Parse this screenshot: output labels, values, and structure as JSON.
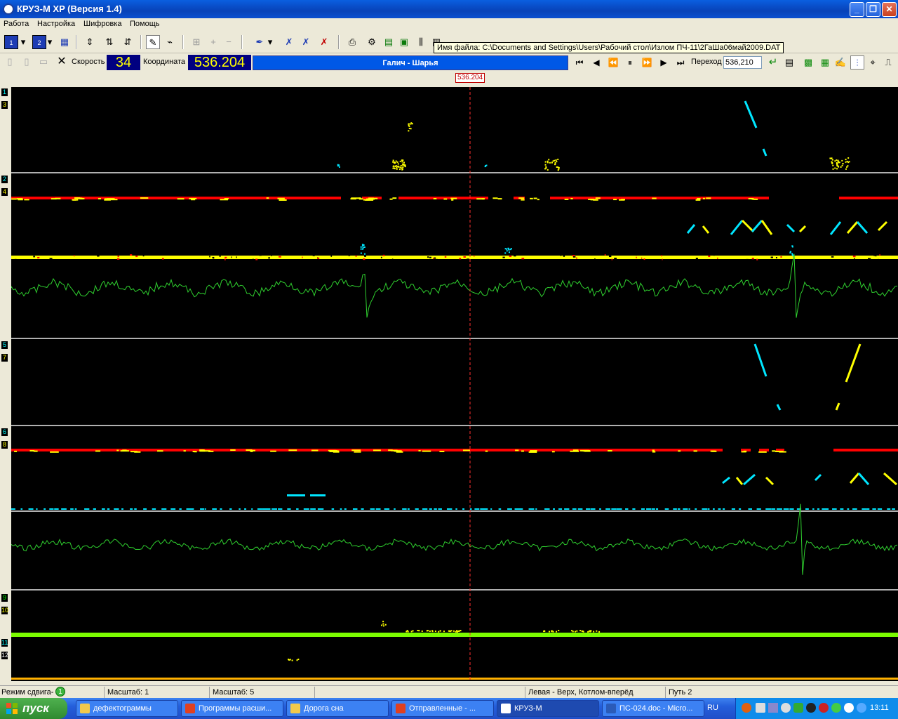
{
  "window": {
    "title": "КРУЗ-М XP (Версия 1.4)",
    "buttons": [
      "_",
      "❐",
      "✕"
    ]
  },
  "menu": [
    "Работа",
    "Настройка",
    "Шифровка",
    "Помощь"
  ],
  "tooltip": "Имя файла: C:\\Documents and Settings\\Users\\Рабочий стол\\Излом ПЧ-11\\2ГаШа06май2009.DAT",
  "nav": {
    "speed_label": "Скорость",
    "speed_value": "34",
    "coord_label": "Координата",
    "coord_value": "536.204",
    "route": "Галич - Шарья",
    "goto_label": "Переход",
    "goto_value": "536,210"
  },
  "ruler": {
    "marker": "536.204"
  },
  "channels": [
    {
      "label": "1",
      "color": "#00FFFF"
    },
    {
      "label": "3",
      "color": "#FFFF00"
    },
    {
      "label": "2",
      "color": "#00FFFF"
    },
    {
      "label": "4",
      "color": "#FFFF00"
    },
    {
      "label": "5",
      "color": "#00FFFF"
    },
    {
      "label": "7",
      "color": "#FFFF00"
    },
    {
      "label": "6",
      "color": "#00FFFF"
    },
    {
      "label": "8",
      "color": "#FFFF00"
    },
    {
      "label": "9",
      "color": "#00FF00"
    },
    {
      "label": "10",
      "color": "#FFFF00"
    },
    {
      "label": "11",
      "color": "#00FFFF"
    },
    {
      "label": "12",
      "color": "#FFFFFF"
    }
  ],
  "status": {
    "shift_mode": "Режим сдвига-",
    "shift_value": "1",
    "scale1": "Масштаб: 1",
    "scale2": "Масштаб: 5",
    "direction": "Левая - Верх, Котлом-вперёд",
    "track": "Путь 2"
  },
  "taskbar": {
    "start": "пуск",
    "tasks": [
      {
        "label": "дефектограммы",
        "icon": "folder-icon"
      },
      {
        "label": "Программы расши...",
        "icon": "opera-icon"
      },
      {
        "label": "Дорога сна",
        "icon": "folder-icon"
      },
      {
        "label": "Отправленные - ...",
        "icon": "opera-icon"
      },
      {
        "label": "КРУЗ-М",
        "icon": "app-icon",
        "active": true
      },
      {
        "label": "ПС-024.doc - Micro...",
        "icon": "word-icon"
      }
    ],
    "lang": "RU",
    "clock": "13:11"
  },
  "colors": {
    "cyan": "#00E6FF",
    "yellow": "#FFFF00",
    "red": "#FF0000",
    "green_trace": "#2FD02F",
    "lime": "#7CFC00",
    "cursor": "#FF3030"
  }
}
